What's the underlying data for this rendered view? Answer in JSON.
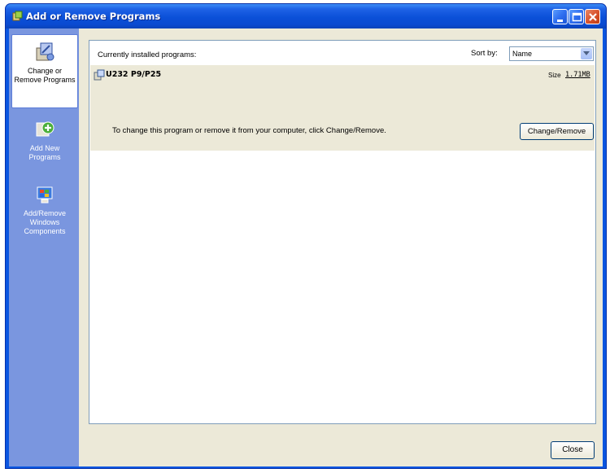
{
  "window": {
    "title": "Add or Remove Programs",
    "title_icon": "add-remove-programs-icon"
  },
  "sidebar": {
    "items": [
      {
        "label": "Change or Remove Programs",
        "icon": "change-remove-programs-icon",
        "active": true
      },
      {
        "label": "Add New Programs",
        "icon": "add-new-programs-icon",
        "active": false
      },
      {
        "label": "Add/Remove Windows Components",
        "icon": "windows-components-icon",
        "active": false
      }
    ]
  },
  "main": {
    "installed_label": "Currently installed programs:",
    "sort_label": "Sort by:",
    "sort_value": "Name"
  },
  "program": {
    "name": "U232 P9/P25",
    "size_label": "Size",
    "size_value": "1.71MB",
    "description": "To change this program or remove it from your computer, click Change/Remove.",
    "change_button": "Change/Remove"
  },
  "footer": {
    "close_button": "Close"
  },
  "colors": {
    "titlebar": "#0b50d8",
    "sidebar": "#7a96df",
    "selected_row": "#ece9d8",
    "client_bg": "#ece9d8"
  }
}
